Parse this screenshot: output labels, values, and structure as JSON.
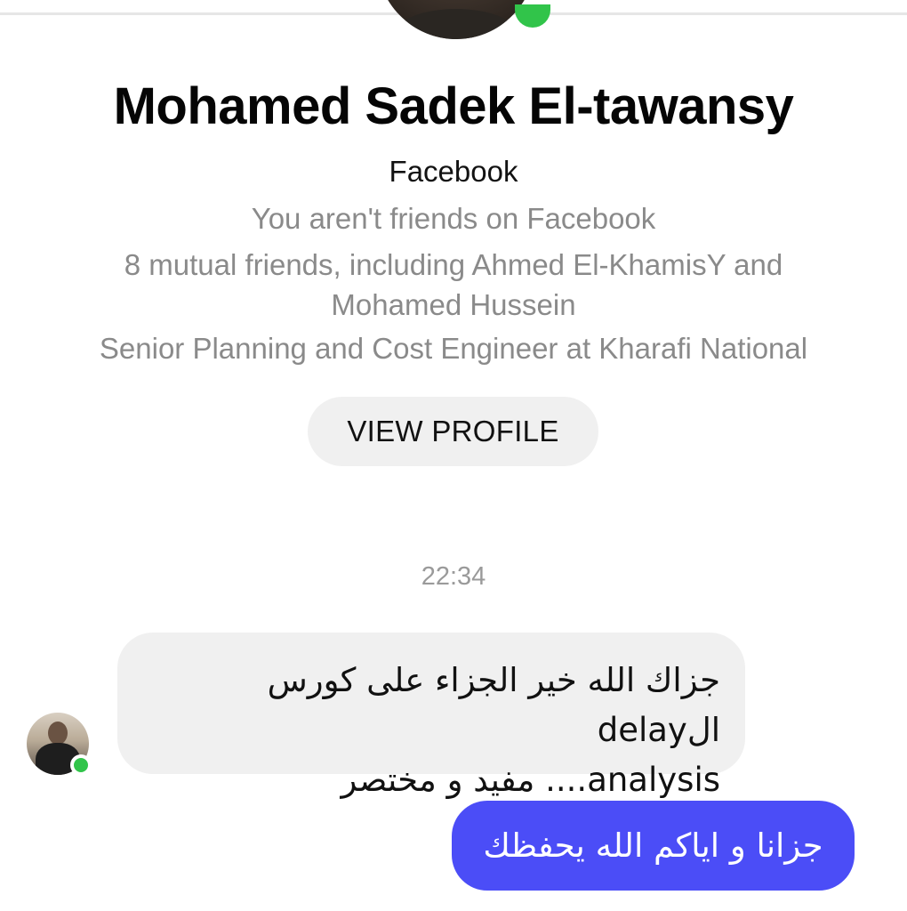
{
  "profile": {
    "name": "Mohamed Sadek El-tawansy",
    "platform": "Facebook",
    "friend_status": "You aren't friends on Facebook",
    "mutual_friends_line1": "8 mutual friends, including Ahmed El-KhamisY and",
    "mutual_friends_line2": "Mohamed Hussein",
    "job": "Senior Planning and Cost Engineer at Kharafi National",
    "view_profile_label": "VIEW PROFILE"
  },
  "conversation": {
    "timestamp": "22:34",
    "messages": [
      {
        "direction": "incoming",
        "line1": "جزاك الله خير الجزاء على كورس الdelay",
        "line2": "analysis.... مفيد و مختصر"
      },
      {
        "direction": "outgoing",
        "text": "جزانا و اياكم الله يحفظك"
      }
    ]
  },
  "colors": {
    "online": "#31c44a",
    "outgoing_bubble": "#4b4df7",
    "incoming_bubble": "#f0f0f0",
    "secondary_text": "#8a8a8a"
  },
  "icons": {
    "profile_avatar": "profile-photo-avatar",
    "online_indicator": "online-status-dot"
  }
}
